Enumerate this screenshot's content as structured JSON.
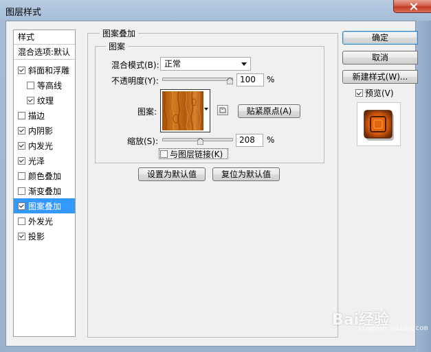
{
  "window": {
    "title": "图层样式"
  },
  "style_list": {
    "header": "样式",
    "blend_default": "混合选项:默认",
    "items": [
      {
        "label": "斜面和浮雕",
        "checked": true,
        "indent": false,
        "selected": false
      },
      {
        "label": "等高线",
        "checked": false,
        "indent": true,
        "selected": false
      },
      {
        "label": "纹理",
        "checked": true,
        "indent": true,
        "selected": false
      },
      {
        "label": "描边",
        "checked": false,
        "indent": false,
        "selected": false
      },
      {
        "label": "内阴影",
        "checked": true,
        "indent": false,
        "selected": false
      },
      {
        "label": "内发光",
        "checked": true,
        "indent": false,
        "selected": false
      },
      {
        "label": "光泽",
        "checked": true,
        "indent": false,
        "selected": false
      },
      {
        "label": "颜色叠加",
        "checked": false,
        "indent": false,
        "selected": false
      },
      {
        "label": "渐变叠加",
        "checked": false,
        "indent": false,
        "selected": false
      },
      {
        "label": "图案叠加",
        "checked": true,
        "indent": false,
        "selected": true
      },
      {
        "label": "外发光",
        "checked": false,
        "indent": false,
        "selected": false
      },
      {
        "label": "投影",
        "checked": true,
        "indent": false,
        "selected": false
      }
    ]
  },
  "pattern_overlay": {
    "group_title": "图案叠加",
    "sub_title": "图案",
    "blend_mode_label": "混合模式(B):",
    "blend_mode_value": "正常",
    "opacity_label": "不透明度(Y):",
    "opacity_value": "100",
    "opacity_fraction": 1.0,
    "percent": "%",
    "pattern_label": "图案:",
    "snap_origin_button": "贴紧原点(A)",
    "scale_label": "缩放(S):",
    "scale_value": "208",
    "link_with_layer_label": "与图层链接(K)",
    "link_with_layer_checked": false,
    "set_default_button": "设置为默认值",
    "reset_default_button": "复位为默认值"
  },
  "buttons": {
    "ok": "确定",
    "cancel": "取消",
    "new_style": "新建样式(W)...",
    "preview_label": "预览(V)",
    "preview_checked": true
  },
  "watermark": {
    "text": "Bai经验",
    "sub": "jingyan.baidu.com"
  },
  "colors": {
    "selection": "#3399ff",
    "pattern_wood": "#c0620f"
  }
}
